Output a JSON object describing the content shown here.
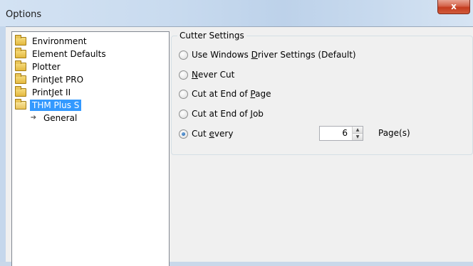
{
  "window": {
    "title": "Options",
    "close_glyph": "x"
  },
  "tree": {
    "items": [
      {
        "label": "Environment"
      },
      {
        "label": "Element Defaults"
      },
      {
        "label": "Plotter"
      },
      {
        "label": "PrintJet PRO"
      },
      {
        "label": "PrintJet II"
      },
      {
        "label": "THM Plus S",
        "selected": true,
        "expanded": true
      },
      {
        "label": "General",
        "child": true
      }
    ]
  },
  "cutter": {
    "group_title": "Cutter Settings",
    "options": [
      {
        "pre": "Use Windows ",
        "key": "D",
        "post": "river Settings (Default)",
        "checked": false
      },
      {
        "pre": "",
        "key": "N",
        "post": "ever Cut",
        "checked": false
      },
      {
        "pre": "Cut at End of ",
        "key": "P",
        "post": "age",
        "checked": false
      },
      {
        "pre": "Cut at End of ",
        "key": "J",
        "post": "ob",
        "checked": false
      },
      {
        "pre": "Cut ",
        "key": "e",
        "post": "very",
        "checked": true
      }
    ],
    "cut_every_value": "6",
    "unit_label": "Page(s)"
  },
  "icons": {
    "folder": "folder-icon",
    "open_folder": "folder-open-icon",
    "child": "arrow-right-icon",
    "spin_up": "▲",
    "spin_down": "▼",
    "arrow": "➔"
  }
}
